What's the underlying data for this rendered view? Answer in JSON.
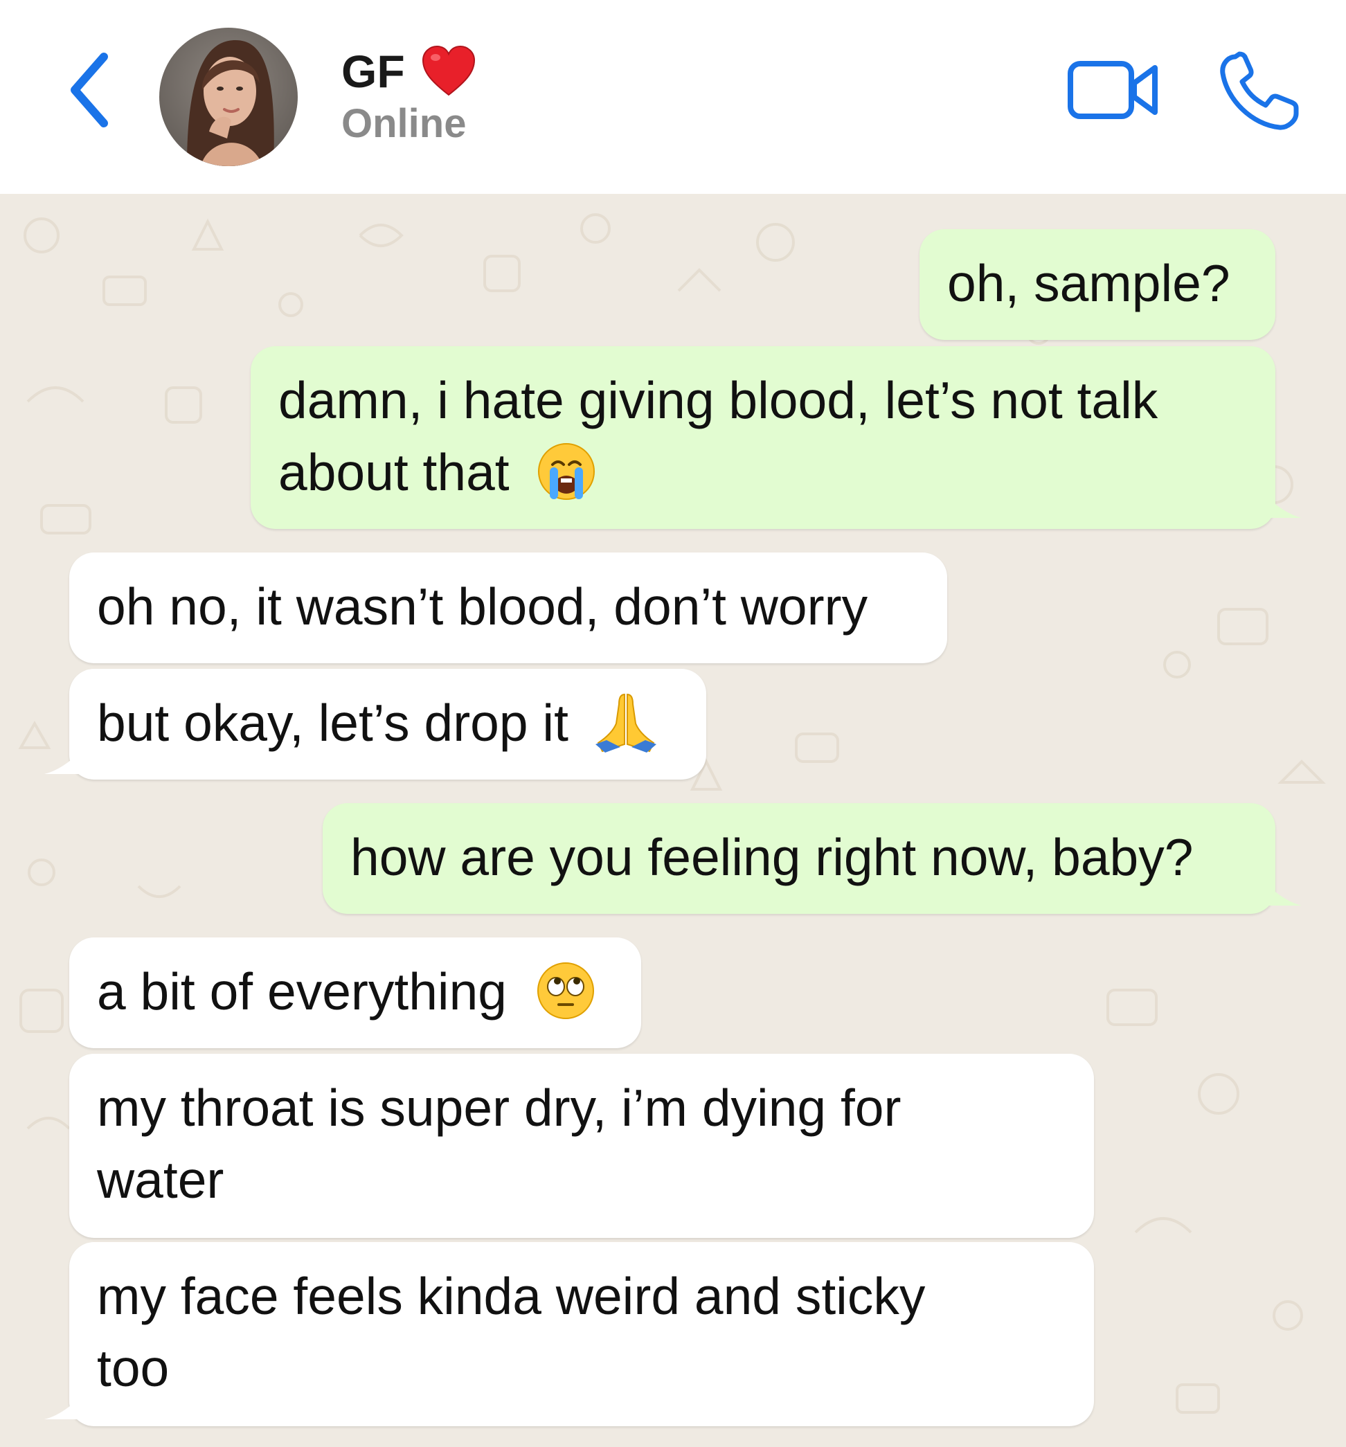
{
  "header": {
    "contact_name": "GF",
    "status": "Online"
  },
  "icons": {
    "back": "chevron-left-icon",
    "heart": "red-heart-emoji",
    "video": "video-camera-icon",
    "call": "phone-icon"
  },
  "colors": {
    "accent": "#1a73e8",
    "outgoing_bubble": "#e2fcd1",
    "incoming_bubble": "#ffffff",
    "chat_background": "#efeae2",
    "status_text": "#8a8a8a"
  },
  "messages": [
    {
      "direction": "outgoing",
      "text": "oh, sample?"
    },
    {
      "direction": "outgoing",
      "line1": "damn, i hate giving blood, let’s not talk",
      "line2": "about that",
      "emoji": "loudly-crying-face"
    },
    {
      "direction": "incoming",
      "text": "oh no, it wasn’t blood, don’t worry"
    },
    {
      "direction": "incoming",
      "text": "but okay, let’s drop it",
      "emoji": "folded-hands"
    },
    {
      "direction": "outgoing",
      "text": "how are you feeling right now, baby?"
    },
    {
      "direction": "incoming",
      "text": "a bit of everything",
      "emoji": "face-with-rolling-eyes"
    },
    {
      "direction": "incoming",
      "line1": "my throat is super dry, i’m dying for",
      "line2": "water"
    },
    {
      "direction": "incoming",
      "line1": "my face feels kinda weird and sticky",
      "line2": "too"
    }
  ]
}
